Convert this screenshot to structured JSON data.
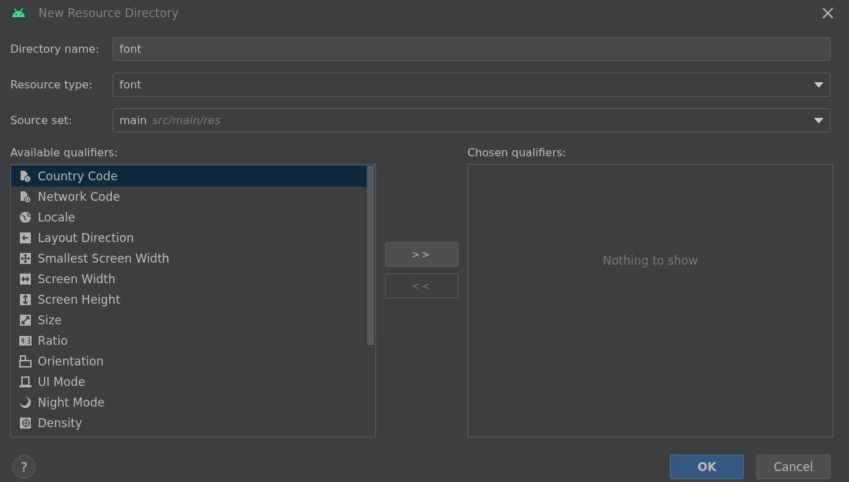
{
  "window": {
    "title": "New Resource Directory",
    "close": "×"
  },
  "fields": [
    {
      "kind": "text",
      "label": "Directory name:",
      "value": "font"
    },
    {
      "kind": "dropdown",
      "label": "Resource type:",
      "value": "font"
    },
    {
      "kind": "dropdown",
      "label": "Source set:",
      "value": "main",
      "detail": "src/main/res"
    }
  ],
  "available_qualifiers": {
    "label": "Available qualifiers:",
    "items": [
      {
        "label": "Country Code",
        "selected": true
      },
      {
        "label": "Network Code",
        "selected": false
      },
      {
        "label": "Locale",
        "selected": false
      },
      {
        "label": "Layout Direction",
        "selected": false
      },
      {
        "label": "Smallest Screen Width",
        "selected": false
      },
      {
        "label": "Screen Width",
        "selected": false
      },
      {
        "label": "Screen Height",
        "selected": false
      },
      {
        "label": "Size",
        "selected": false
      },
      {
        "label": "Ratio",
        "selected": false
      },
      {
        "label": "Orientation",
        "selected": false
      },
      {
        "label": "UI Mode",
        "selected": false
      },
      {
        "label": "Night Mode",
        "selected": false
      },
      {
        "label": "Density",
        "selected": false
      }
    ]
  },
  "move_buttons": [
    {
      "label": ">>",
      "disabled": false
    },
    {
      "label": "<<",
      "disabled": true
    }
  ],
  "chosen_qualifiers": {
    "label": "Chosen qualifiers:",
    "empty_text": "Nothing to show"
  },
  "help": "?",
  "buttons": [
    {
      "label": "OK",
      "kind": "primary"
    },
    {
      "label": "Cancel",
      "kind": "secondary"
    }
  ]
}
